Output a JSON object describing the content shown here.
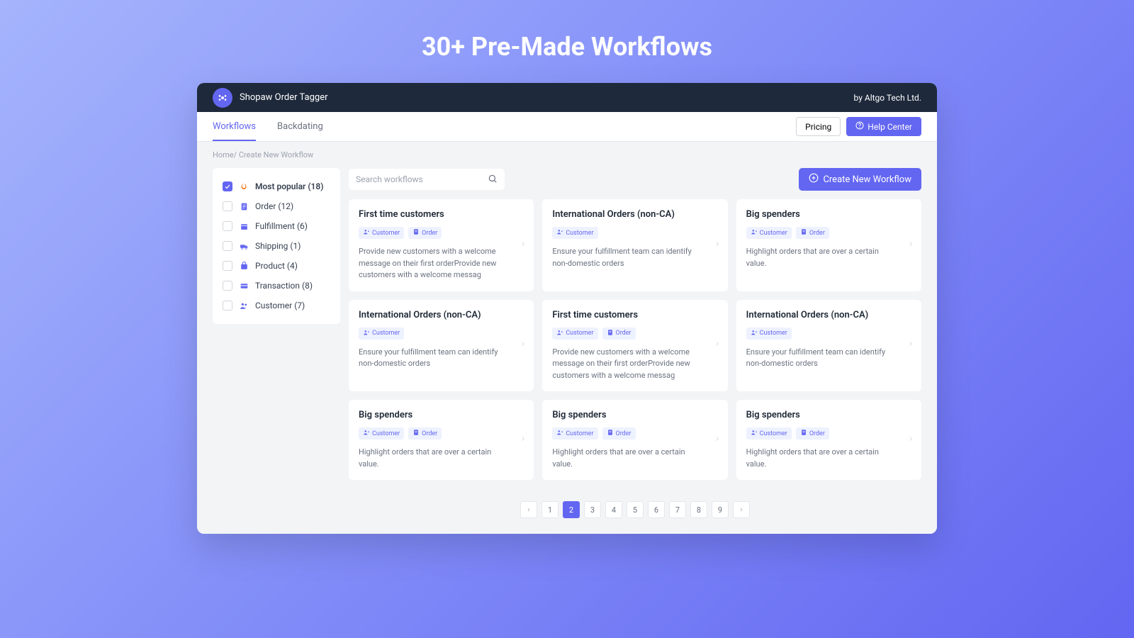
{
  "hero": {
    "title": "30+ Pre-Made Workflows"
  },
  "header": {
    "app_name": "Shopaw Order Tagger",
    "vendor": "by Altgo Tech Ltd."
  },
  "nav": {
    "tabs": [
      {
        "label": "Workflows",
        "active": true
      },
      {
        "label": "Backdating",
        "active": false
      }
    ],
    "pricing": "Pricing",
    "help": "Help Center"
  },
  "breadcrumb": {
    "home": "Home",
    "current": "Create New Workflow"
  },
  "sidebar": {
    "filters": [
      {
        "label": "Most popular",
        "count": "(18)",
        "icon": "fire",
        "checked": true
      },
      {
        "label": "Order",
        "count": "(12)",
        "icon": "order",
        "checked": false
      },
      {
        "label": "Fulfillment",
        "count": "(6)",
        "icon": "fulfill",
        "checked": false
      },
      {
        "label": "Shipping",
        "count": "(1)",
        "icon": "shipping",
        "checked": false
      },
      {
        "label": "Product",
        "count": "(4)",
        "icon": "product",
        "checked": false
      },
      {
        "label": "Transaction",
        "count": "(8)",
        "icon": "transaction",
        "checked": false
      },
      {
        "label": "Customer",
        "count": "(7)",
        "icon": "customer",
        "checked": false
      }
    ]
  },
  "toolbar": {
    "search_placeholder": "Search workflows",
    "create_label": "Create New Workflow"
  },
  "tags": {
    "customer": "Customer",
    "order": "Order"
  },
  "cards": [
    {
      "title": "First time customers",
      "tags": [
        "customer",
        "order"
      ],
      "desc": "Provide new customers with a welcome message on their first orderProvide new customers with a welcome messag"
    },
    {
      "title": "International Orders (non-CA)",
      "tags": [
        "customer"
      ],
      "desc": "Ensure your fulfillment team can identify non-domestic orders"
    },
    {
      "title": "Big spenders",
      "tags": [
        "customer",
        "order"
      ],
      "desc": "Highlight orders that are over a certain value."
    },
    {
      "title": "International Orders (non-CA)",
      "tags": [
        "customer"
      ],
      "desc": "Ensure your fulfillment team can identify non-domestic orders"
    },
    {
      "title": "First time customers",
      "tags": [
        "customer",
        "order"
      ],
      "desc": "Provide new customers with a welcome message on their first orderProvide new customers with a welcome messag"
    },
    {
      "title": "International Orders (non-CA)",
      "tags": [
        "customer"
      ],
      "desc": "Ensure your fulfillment team can identify non-domestic orders"
    },
    {
      "title": "Big spenders",
      "tags": [
        "customer",
        "order"
      ],
      "desc": "Highlight orders that are over a certain value."
    },
    {
      "title": "Big spenders",
      "tags": [
        "customer",
        "order"
      ],
      "desc": "Highlight orders that are over a certain value."
    },
    {
      "title": "Big spenders",
      "tags": [
        "customer",
        "order"
      ],
      "desc": "Highlight orders that are over a certain value."
    }
  ],
  "pagination": {
    "pages": [
      "1",
      "2",
      "3",
      "4",
      "5",
      "6",
      "7",
      "8",
      "9"
    ],
    "active": "2"
  },
  "icons": {
    "fire": "🔥",
    "order": "📋",
    "fulfill": "📦",
    "shipping": "🚚",
    "product": "🛍",
    "transaction": "💳",
    "customer": "👥"
  }
}
